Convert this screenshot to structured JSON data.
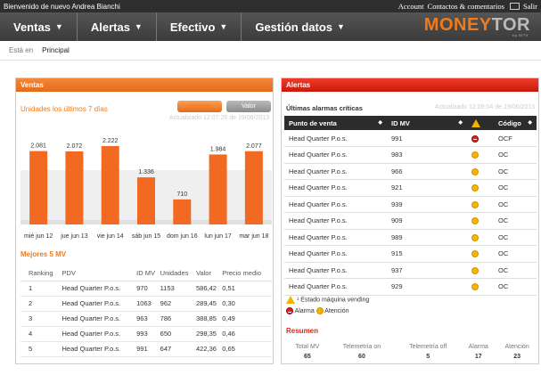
{
  "topbar": {
    "welcome": "Bienvenido de nuevo Andrea Bianchi",
    "account": "Account",
    "contacts": "Contactos & comentarios",
    "logout": "Salir"
  },
  "nav": {
    "items": [
      "Ventas",
      "Alertas",
      "Efectivo",
      "Gestión datos"
    ],
    "logo_a": "MONEY",
    "logo_b": "TOR",
    "logo_sub": "by BITX"
  },
  "breadcrumb": {
    "label": "Está en",
    "current": "Principal"
  },
  "ventas": {
    "header": "Ventas",
    "subtitle": "Unidades los últimos 7 días",
    "btn_unidades": "Unidades",
    "btn_valor": "Valor",
    "updated": "Actualizado 12:07:26 de 19/06/2013",
    "mejores": "Mejores 5 MV",
    "rank_headers": [
      "Ranking",
      "PDV",
      "ID MV",
      "Unidades",
      "Valor",
      "Precio medio"
    ],
    "rank_rows": [
      [
        "1",
        "Head Quarter P.o.s.",
        "970",
        "1153",
        "586,42",
        "0,51"
      ],
      [
        "2",
        "Head Quarter P.o.s.",
        "1063",
        "962",
        "289,45",
        "0,30"
      ],
      [
        "3",
        "Head Quarter P.o.s.",
        "963",
        "786",
        "388,85",
        "0,49"
      ],
      [
        "4",
        "Head Quarter P.o.s.",
        "993",
        "650",
        "298,35",
        "0,46"
      ],
      [
        "5",
        "Head Quarter P.o.s.",
        "991",
        "647",
        "422,36",
        "0,65"
      ]
    ]
  },
  "chart_data": {
    "type": "bar",
    "categories": [
      "mié jun 12",
      "jue jun 13",
      "vie jun 14",
      "sáb jun 15",
      "dom jun 16",
      "lun jun 17",
      "mar jun 18"
    ],
    "values": [
      2081,
      2072,
      2222,
      1336,
      710,
      1984,
      2077
    ],
    "labels": [
      "2.081",
      "2.072",
      "2.222",
      "1.336",
      "710",
      "1.984",
      "2.077"
    ],
    "color": "#f26a22",
    "ylim": [
      0,
      3000
    ]
  },
  "alertas": {
    "header": "Alertas",
    "subtitle": "Últimas alarmas críticas",
    "updated": "Actualizado 12:09:04 de 19/06/2013",
    "headers": [
      "Punto de venta",
      "ID MV",
      "",
      "Código"
    ],
    "rows": [
      [
        "Head Quarter P.o.s.",
        "991",
        "r",
        "OCF"
      ],
      [
        "Head Quarter P.o.s.",
        "983",
        "y",
        "OC"
      ],
      [
        "Head Quarter P.o.s.",
        "966",
        "y",
        "OC"
      ],
      [
        "Head Quarter P.o.s.",
        "921",
        "y",
        "OC"
      ],
      [
        "Head Quarter P.o.s.",
        "939",
        "y",
        "OC"
      ],
      [
        "Head Quarter P.o.s.",
        "909",
        "y",
        "OC"
      ],
      [
        "Head Quarter P.o.s.",
        "989",
        "y",
        "OC"
      ],
      [
        "Head Quarter P.o.s.",
        "915",
        "y",
        "OC"
      ],
      [
        "Head Quarter P.o.s.",
        "937",
        "y",
        "OC"
      ],
      [
        "Head Quarter P.o.s.",
        "929",
        "y",
        "OC"
      ]
    ],
    "legend_state": "Estado máquina vending",
    "legend_alarma": "Alarma",
    "legend_atencion": "Atención",
    "resumen": "Resumen",
    "res_headers": [
      "Total MV",
      "Telemetría on",
      "Telemetría off",
      "Alarma",
      "Atención"
    ],
    "res_values": [
      "65",
      "60",
      "5",
      "17",
      "23"
    ]
  }
}
